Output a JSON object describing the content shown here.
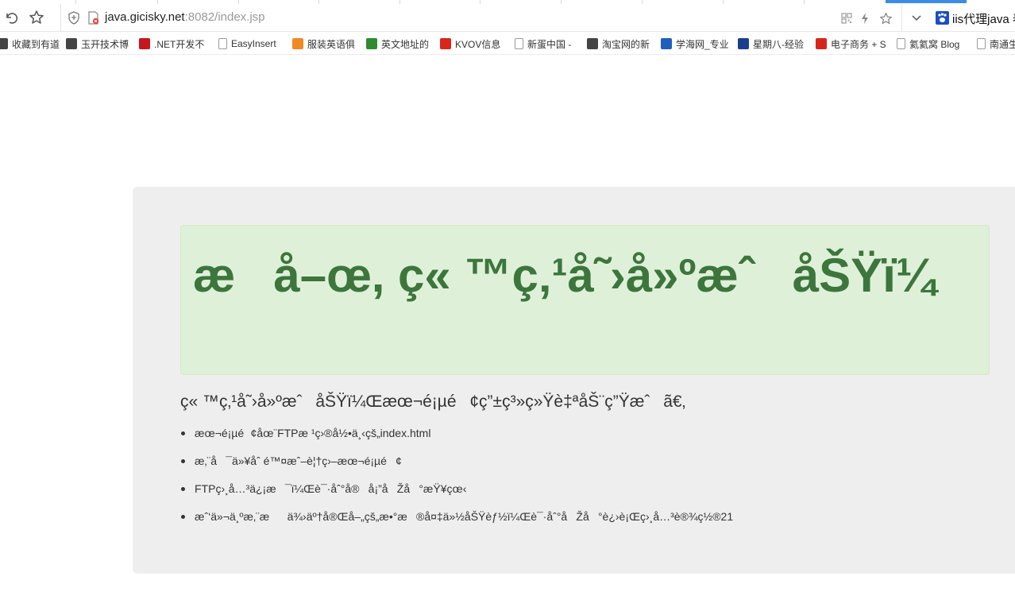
{
  "browser": {
    "address": {
      "host": "java.gicisky.net",
      "path": ":8082/index.jsp"
    },
    "side_panel_label": "iis代理java 春"
  },
  "bookmarks": [
    {
      "label": "收藏到有道",
      "icon": "youdao-icon",
      "color": "#444444"
    },
    {
      "label": "玉开技术博",
      "icon": "fire-icon",
      "color": "#444444"
    },
    {
      "label": ".NET开发不",
      "icon": "csdn-icon",
      "color": "#c8161e"
    },
    {
      "label": "EasyInsert",
      "icon": "page-icon",
      "color": "#9a9a9a"
    },
    {
      "label": "服装英语俱",
      "icon": "swirl-icon",
      "color": "#f08a24"
    },
    {
      "label": "英文地址的",
      "icon": "guan-icon",
      "color": "#2e8b2e"
    },
    {
      "label": "KVOV信息",
      "icon": "kvov-icon",
      "color": "#d9261c"
    },
    {
      "label": "新蛋中国 -",
      "icon": "page-icon",
      "color": "#9a9a9a"
    },
    {
      "label": "淘宝网的新",
      "icon": "fire-icon",
      "color": "#444444"
    },
    {
      "label": "学海网_专业",
      "icon": "ship-icon",
      "color": "#1f5fbf"
    },
    {
      "label": "星期八-经验",
      "icon": "hd-icon",
      "color": "#1b3f8f"
    },
    {
      "label": "电子商务 + S",
      "icon": "zz-icon",
      "color": "#d9261c"
    },
    {
      "label": "氦氦窝 Blog",
      "icon": "page-icon",
      "color": "#9a9a9a"
    },
    {
      "label": "南通生",
      "icon": "page-icon",
      "color": "#9a9a9a"
    }
  ],
  "page": {
    "headline": "æå–œ, ç« ™ç‚¹å˜›å»ºæˆåŠŸï¼",
    "intro": "ç« ™ç‚¹å˜›å»ºæˆåŠŸï¼Œæœ¬é¡µé¢ç”±ç³»ç»Ÿè‡ªåŠ¨ç”Ÿæˆã€‚",
    "tips": [
      "æœ¬é¡µé¢åœ¨FTPæ ¹ç›®å½•ä¸‹çš„index.html",
      "æ‚¨å¯ä»¥åˆ é™¤æˆ–è¦†ç›–æœ¬é¡µé¢",
      "FTPç›¸å…³ä¿¡æ¯ï¼Œè¯·åˆ°å®å¡”åŽå°æŸ¥çœ‹",
      "æˆ‘ä»¬ä¸ºæ‚¨æä¾›äº†å®Œå–„çš„æ•°æ®å¤‡ä»½åŠŸèƒ½ï¼Œè¯·åˆ°åŽå°è¿›è¡Œç›¸å…³è®¾ç½®21"
    ]
  }
}
